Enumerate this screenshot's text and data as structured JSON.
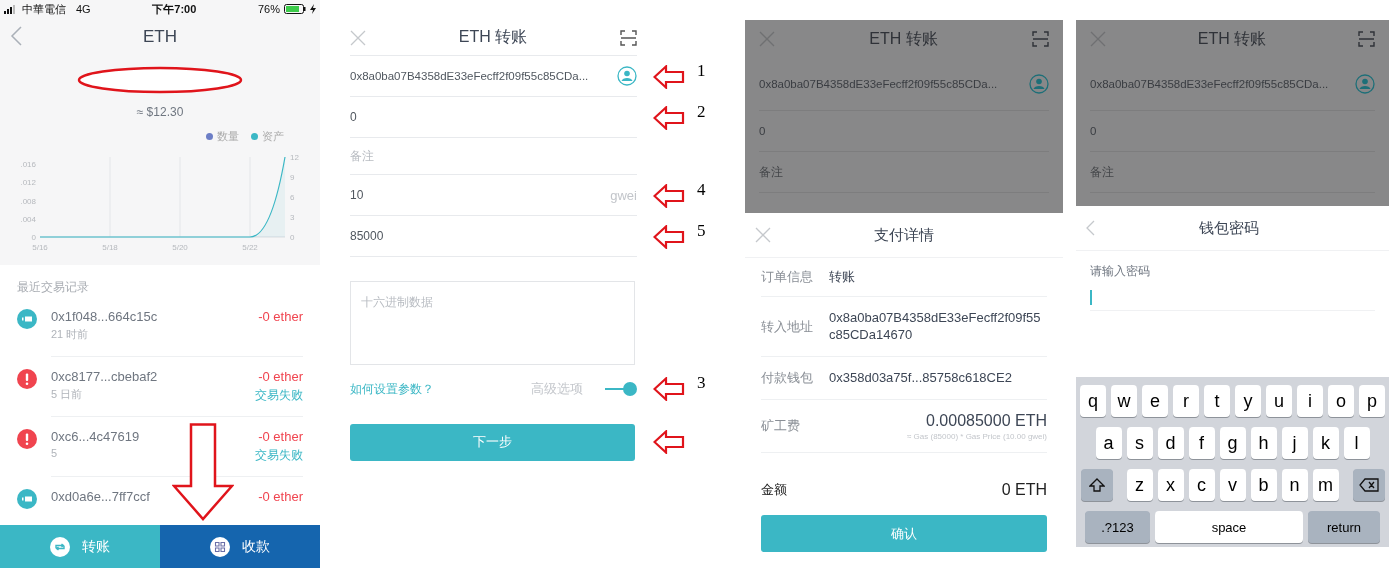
{
  "wallet_screen": {
    "status_bar": {
      "carrier": "中華電信",
      "network": "4G",
      "time": "下午7:00",
      "battery": "76%"
    },
    "title": "ETH",
    "balance_usd": "≈ $12.30",
    "chart_data": {
      "type": "line",
      "x": [
        "5/16",
        null,
        "5/18",
        null,
        "5/20",
        null,
        "5/22",
        null
      ],
      "grid": true,
      "ylim": [
        0,
        0.0176
      ],
      "yticks": [
        {
          "value": 0,
          "label": "0"
        },
        {
          "value": 0.004,
          "label": ".004"
        },
        {
          "value": 0.008,
          "label": ".008"
        },
        {
          "value": 0.012,
          "label": ".012"
        },
        {
          "value": 0.016,
          "label": ".016"
        }
      ],
      "y2lim": [
        0,
        12
      ],
      "y2ticks": [
        0,
        3,
        6,
        9,
        12
      ],
      "series": [
        {
          "name": "数量",
          "color": "#6c7ec6",
          "values": [
            null,
            null,
            null,
            null,
            null,
            null,
            null,
            null
          ]
        },
        {
          "name": "资产",
          "color": "#3bb7c5",
          "axis": "y2",
          "values": [
            0,
            0,
            0,
            0,
            0,
            0,
            0,
            12
          ]
        }
      ]
    },
    "section_title": "最近交易记录",
    "transactions": [
      {
        "kind": "sent",
        "hash": "0x1f048...664c15c",
        "time": "21 时前",
        "amount": "-0 ether"
      },
      {
        "kind": "failed",
        "hash": "0xc8177...cbebaf2",
        "time": "5 日前",
        "amount": "-0 ether",
        "status": "交易失败"
      },
      {
        "kind": "failed",
        "hash": "0xc6...4c47619",
        "time": "5",
        "amount": "-0 ether",
        "status": "交易失败"
      },
      {
        "kind": "sent",
        "hash": "0xd0a6e...7ff7ccf",
        "amount": "-0 ether"
      }
    ],
    "bottom_bar": [
      {
        "kind": "transfer",
        "label": "转账"
      },
      {
        "kind": "receive",
        "label": "收款"
      }
    ]
  },
  "transfer_form": {
    "title": "ETH 转账",
    "fields": [
      {
        "kind": "address",
        "value": "0x8a0ba07B4358dE33eFecff2f09f55c85CDa...",
        "annotation": "1"
      },
      {
        "kind": "amount",
        "value": "0",
        "annotation": "2"
      },
      {
        "kind": "note",
        "placeholder": "备注"
      },
      {
        "kind": "gas_price",
        "value": "10",
        "unit": "gwei",
        "annotation": "4"
      },
      {
        "kind": "gas_limit",
        "value": "85000",
        "annotation": "5"
      }
    ],
    "hex_data": {
      "placeholder": "十六进制数据"
    },
    "help_link": "如何设置参数？",
    "advanced": {
      "label": "高级选项",
      "on": true,
      "annotation": "3"
    },
    "next_button": {
      "label": "下一步",
      "arrow": true
    }
  },
  "payment_screen": {
    "background": {
      "title": "ETH 转账",
      "address": "0x8a0ba07B4358dE33eFecff2f09f55c85CDa...",
      "amount": "0",
      "note_placeholder": "备注"
    },
    "title": "支付详情",
    "rows": [
      {
        "label": "订单信息",
        "value": "转账"
      },
      {
        "label": "转入地址",
        "value": "0x8a0ba07B4358dE33eFecff2f09f55c85CDa14670"
      },
      {
        "label": "付款钱包",
        "value": "0x358d03a75f...85758c618CE2"
      },
      {
        "label": "矿工费",
        "value": "0.00085000 ETH",
        "note": "≈ Gas (85000) * Gas Price (10.00 gwei)"
      }
    ],
    "total": {
      "label": "金额",
      "value": "0 ETH"
    },
    "confirm_button": "确认"
  },
  "password_screen": {
    "background": {
      "title": "ETH 转账",
      "address": "0x8a0ba07B4358dE33eFecff2f09f55c85CDa...",
      "amount": "0",
      "note_placeholder": "备注"
    },
    "title": "钱包密码",
    "field_label": "请输入密码",
    "keyboard": {
      "rows": [
        [
          "q",
          "w",
          "e",
          "r",
          "t",
          "y",
          "u",
          "i",
          "o",
          "p"
        ],
        [
          "a",
          "s",
          "d",
          "f",
          "g",
          "h",
          "j",
          "k",
          "l"
        ],
        [
          "z",
          "x",
          "c",
          "v",
          "b",
          "n",
          "m"
        ]
      ],
      "bottom": [
        {
          "kind": "mode",
          "label": ".?123"
        },
        {
          "kind": "space",
          "label": "space"
        },
        {
          "kind": "return",
          "label": "return"
        }
      ]
    }
  }
}
